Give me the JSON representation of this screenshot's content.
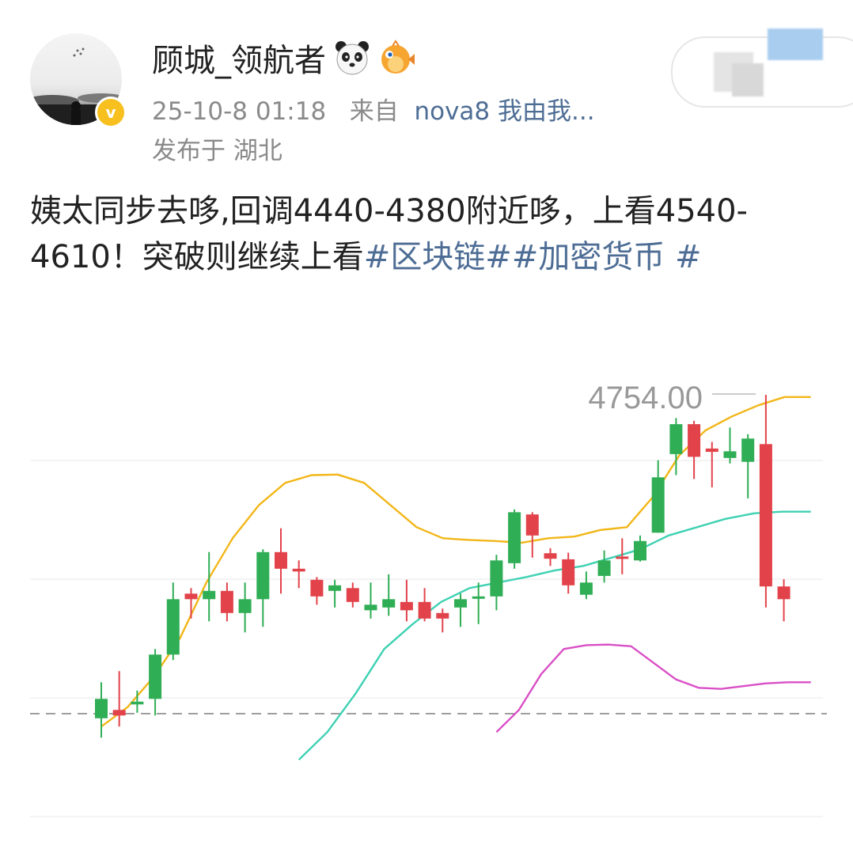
{
  "post": {
    "username": "顾城_领航者",
    "time": "25-10-8 01:18",
    "from_label": "来自",
    "source": "nova8 我由我...",
    "location": "发布于 湖北",
    "text_main": "姨太同步去哆,回调4440-4380附近哆，上看4540-4610！突破则继续上看",
    "tags": [
      "#区块链#",
      "#加密货币 #"
    ]
  },
  "icons": {
    "emoji_1": "panda-face-icon",
    "emoji_2": "blowfish-icon",
    "badge": "verified-v-icon"
  },
  "colors": {
    "link": "#4e6d95",
    "bull": "#2fae55",
    "bear": "#e2434b",
    "ma_short": "#f2b618",
    "ma_mid": "#3fd1b3",
    "ma_long": "#d94fc6"
  },
  "verified_mark": "v",
  "chart_data": {
    "type": "candlestick",
    "top_label": "4754.00",
    "candles": [
      {
        "o": 4175,
        "c": 4210,
        "h": 4240,
        "l": 4140
      },
      {
        "o": 4190,
        "c": 4180,
        "h": 4260,
        "l": 4160
      },
      {
        "o": 4200,
        "c": 4205,
        "h": 4225,
        "l": 4185
      },
      {
        "o": 4210,
        "c": 4290,
        "h": 4300,
        "l": 4180
      },
      {
        "o": 4290,
        "c": 4390,
        "h": 4420,
        "l": 4280
      },
      {
        "o": 4400,
        "c": 4390,
        "h": 4410,
        "l": 4355
      },
      {
        "o": 4390,
        "c": 4405,
        "h": 4475,
        "l": 4350
      },
      {
        "o": 4405,
        "c": 4365,
        "h": 4420,
        "l": 4350
      },
      {
        "o": 4365,
        "c": 4390,
        "h": 4420,
        "l": 4330
      },
      {
        "o": 4390,
        "c": 4475,
        "h": 4480,
        "l": 4340
      },
      {
        "o": 4475,
        "c": 4445,
        "h": 4518,
        "l": 4400
      },
      {
        "o": 4445,
        "c": 4440,
        "h": 4460,
        "l": 4410
      },
      {
        "o": 4425,
        "c": 4395,
        "h": 4430,
        "l": 4380
      },
      {
        "o": 4405,
        "c": 4415,
        "h": 4425,
        "l": 4375
      },
      {
        "o": 4410,
        "c": 4385,
        "h": 4420,
        "l": 4375
      },
      {
        "o": 4370,
        "c": 4380,
        "h": 4420,
        "l": 4355
      },
      {
        "o": 4375,
        "c": 4390,
        "h": 4435,
        "l": 4360
      },
      {
        "o": 4385,
        "c": 4370,
        "h": 4425,
        "l": 4350
      },
      {
        "o": 4385,
        "c": 4355,
        "h": 4410,
        "l": 4350
      },
      {
        "o": 4365,
        "c": 4355,
        "h": 4373,
        "l": 4330
      },
      {
        "o": 4375,
        "c": 4390,
        "h": 4400,
        "l": 4340
      },
      {
        "o": 4395,
        "c": 4395,
        "h": 4420,
        "l": 4345
      },
      {
        "o": 4395,
        "c": 4460,
        "h": 4470,
        "l": 4370
      },
      {
        "o": 4455,
        "c": 4547,
        "h": 4552,
        "l": 4445
      },
      {
        "o": 4543,
        "c": 4505,
        "h": 4547,
        "l": 4465
      },
      {
        "o": 4473,
        "c": 4463,
        "h": 4482,
        "l": 4450
      },
      {
        "o": 4462,
        "c": 4415,
        "h": 4474,
        "l": 4400
      },
      {
        "o": 4398,
        "c": 4420,
        "h": 4440,
        "l": 4390
      },
      {
        "o": 4432,
        "c": 4460,
        "h": 4478,
        "l": 4420
      },
      {
        "o": 4467,
        "c": 4465,
        "h": 4500,
        "l": 4435
      },
      {
        "o": 4460,
        "c": 4495,
        "h": 4505,
        "l": 4458
      },
      {
        "o": 4510,
        "c": 4610,
        "h": 4641,
        "l": 4510
      },
      {
        "o": 4652,
        "c": 4706,
        "h": 4717,
        "l": 4614
      },
      {
        "o": 4706,
        "c": 4647,
        "h": 4712,
        "l": 4607
      },
      {
        "o": 4662,
        "c": 4656,
        "h": 4674,
        "l": 4592
      },
      {
        "o": 4645,
        "c": 4657,
        "h": 4700,
        "l": 4635
      },
      {
        "o": 4638,
        "c": 4680,
        "h": 4688,
        "l": 4572
      },
      {
        "o": 4670,
        "c": 4413,
        "h": 4759,
        "l": 4375
      },
      {
        "o": 4413,
        "c": 4390,
        "h": 4426,
        "l": 4350
      }
    ],
    "ma_short": [
      4160,
      4195,
      4250,
      4320,
      4420,
      4500,
      4560,
      4600,
      4614,
      4615,
      4600,
      4560,
      4520,
      4500,
      4497,
      4495,
      4492,
      4500,
      4503,
      4515,
      4520,
      4575,
      4650,
      4695,
      4720,
      4740,
      4755,
      4755
    ],
    "ma_mid": [
      4100,
      4150,
      4220,
      4300,
      4345,
      4385,
      4410,
      4420,
      4430,
      4442,
      4450,
      4465,
      4480,
      4505,
      4520,
      4535,
      4545,
      4548,
      4548
    ],
    "ma_long": [
      4150,
      4190,
      4255,
      4300,
      4307,
      4308,
      4305,
      4275,
      4245,
      4230,
      4228,
      4233,
      4238,
      4240,
      4240
    ]
  }
}
